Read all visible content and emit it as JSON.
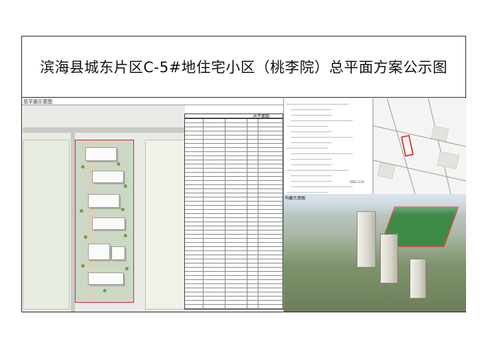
{
  "title": "滨海县城东片区C-5#地住宅小区（桃李院）总平面方案公示图",
  "sections": {
    "site_plan_label": "总平面示意图",
    "table_label": "总平面图",
    "aerial_label": "鸟瞰示意图"
  },
  "notes": {
    "lines": [
      "2021.3.22"
    ]
  },
  "colors": {
    "site_border": "#d23",
    "grass": "#6f9a4f",
    "track": "#b85a3c",
    "pitch": "#3f8a46"
  }
}
